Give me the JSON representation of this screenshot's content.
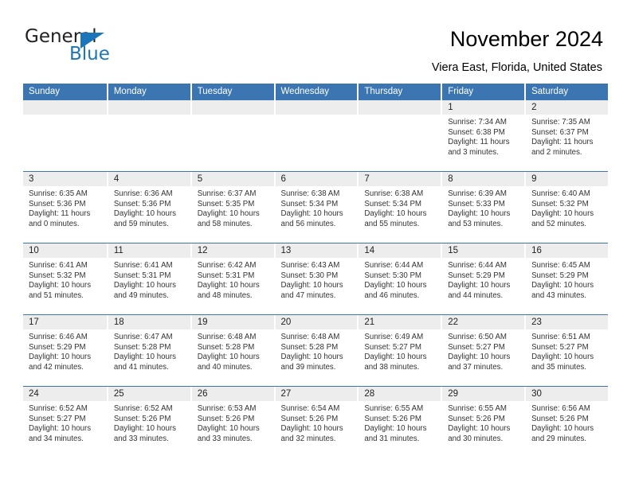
{
  "brand": {
    "name_part1": "General",
    "name_part2": "Blue",
    "accent_color": "#1b75bb",
    "triangle_icon": "triangle-icon"
  },
  "header": {
    "title": "November 2024",
    "subtitle": "Viera East, Florida, United States"
  },
  "calendar": {
    "header_bg": "#3b76b2",
    "daynum_bg": "#ededed",
    "weekday_headers": [
      "Sunday",
      "Monday",
      "Tuesday",
      "Wednesday",
      "Thursday",
      "Friday",
      "Saturday"
    ],
    "weeks": [
      [
        {
          "day": "",
          "sunrise": "",
          "sunset": "",
          "daylight": "",
          "empty": true
        },
        {
          "day": "",
          "sunrise": "",
          "sunset": "",
          "daylight": "",
          "empty": true
        },
        {
          "day": "",
          "sunrise": "",
          "sunset": "",
          "daylight": "",
          "empty": true
        },
        {
          "day": "",
          "sunrise": "",
          "sunset": "",
          "daylight": "",
          "empty": true
        },
        {
          "day": "",
          "sunrise": "",
          "sunset": "",
          "daylight": "",
          "empty": true
        },
        {
          "day": "1",
          "sunrise": "Sunrise: 7:34 AM",
          "sunset": "Sunset: 6:38 PM",
          "daylight": "Daylight: 11 hours and 3 minutes.",
          "empty": false
        },
        {
          "day": "2",
          "sunrise": "Sunrise: 7:35 AM",
          "sunset": "Sunset: 6:37 PM",
          "daylight": "Daylight: 11 hours and 2 minutes.",
          "empty": false
        }
      ],
      [
        {
          "day": "3",
          "sunrise": "Sunrise: 6:35 AM",
          "sunset": "Sunset: 5:36 PM",
          "daylight": "Daylight: 11 hours and 0 minutes.",
          "empty": false
        },
        {
          "day": "4",
          "sunrise": "Sunrise: 6:36 AM",
          "sunset": "Sunset: 5:36 PM",
          "daylight": "Daylight: 10 hours and 59 minutes.",
          "empty": false
        },
        {
          "day": "5",
          "sunrise": "Sunrise: 6:37 AM",
          "sunset": "Sunset: 5:35 PM",
          "daylight": "Daylight: 10 hours and 58 minutes.",
          "empty": false
        },
        {
          "day": "6",
          "sunrise": "Sunrise: 6:38 AM",
          "sunset": "Sunset: 5:34 PM",
          "daylight": "Daylight: 10 hours and 56 minutes.",
          "empty": false
        },
        {
          "day": "7",
          "sunrise": "Sunrise: 6:38 AM",
          "sunset": "Sunset: 5:34 PM",
          "daylight": "Daylight: 10 hours and 55 minutes.",
          "empty": false
        },
        {
          "day": "8",
          "sunrise": "Sunrise: 6:39 AM",
          "sunset": "Sunset: 5:33 PM",
          "daylight": "Daylight: 10 hours and 53 minutes.",
          "empty": false
        },
        {
          "day": "9",
          "sunrise": "Sunrise: 6:40 AM",
          "sunset": "Sunset: 5:32 PM",
          "daylight": "Daylight: 10 hours and 52 minutes.",
          "empty": false
        }
      ],
      [
        {
          "day": "10",
          "sunrise": "Sunrise: 6:41 AM",
          "sunset": "Sunset: 5:32 PM",
          "daylight": "Daylight: 10 hours and 51 minutes.",
          "empty": false
        },
        {
          "day": "11",
          "sunrise": "Sunrise: 6:41 AM",
          "sunset": "Sunset: 5:31 PM",
          "daylight": "Daylight: 10 hours and 49 minutes.",
          "empty": false
        },
        {
          "day": "12",
          "sunrise": "Sunrise: 6:42 AM",
          "sunset": "Sunset: 5:31 PM",
          "daylight": "Daylight: 10 hours and 48 minutes.",
          "empty": false
        },
        {
          "day": "13",
          "sunrise": "Sunrise: 6:43 AM",
          "sunset": "Sunset: 5:30 PM",
          "daylight": "Daylight: 10 hours and 47 minutes.",
          "empty": false
        },
        {
          "day": "14",
          "sunrise": "Sunrise: 6:44 AM",
          "sunset": "Sunset: 5:30 PM",
          "daylight": "Daylight: 10 hours and 46 minutes.",
          "empty": false
        },
        {
          "day": "15",
          "sunrise": "Sunrise: 6:44 AM",
          "sunset": "Sunset: 5:29 PM",
          "daylight": "Daylight: 10 hours and 44 minutes.",
          "empty": false
        },
        {
          "day": "16",
          "sunrise": "Sunrise: 6:45 AM",
          "sunset": "Sunset: 5:29 PM",
          "daylight": "Daylight: 10 hours and 43 minutes.",
          "empty": false
        }
      ],
      [
        {
          "day": "17",
          "sunrise": "Sunrise: 6:46 AM",
          "sunset": "Sunset: 5:29 PM",
          "daylight": "Daylight: 10 hours and 42 minutes.",
          "empty": false
        },
        {
          "day": "18",
          "sunrise": "Sunrise: 6:47 AM",
          "sunset": "Sunset: 5:28 PM",
          "daylight": "Daylight: 10 hours and 41 minutes.",
          "empty": false
        },
        {
          "day": "19",
          "sunrise": "Sunrise: 6:48 AM",
          "sunset": "Sunset: 5:28 PM",
          "daylight": "Daylight: 10 hours and 40 minutes.",
          "empty": false
        },
        {
          "day": "20",
          "sunrise": "Sunrise: 6:48 AM",
          "sunset": "Sunset: 5:28 PM",
          "daylight": "Daylight: 10 hours and 39 minutes.",
          "empty": false
        },
        {
          "day": "21",
          "sunrise": "Sunrise: 6:49 AM",
          "sunset": "Sunset: 5:27 PM",
          "daylight": "Daylight: 10 hours and 38 minutes.",
          "empty": false
        },
        {
          "day": "22",
          "sunrise": "Sunrise: 6:50 AM",
          "sunset": "Sunset: 5:27 PM",
          "daylight": "Daylight: 10 hours and 37 minutes.",
          "empty": false
        },
        {
          "day": "23",
          "sunrise": "Sunrise: 6:51 AM",
          "sunset": "Sunset: 5:27 PM",
          "daylight": "Daylight: 10 hours and 35 minutes.",
          "empty": false
        }
      ],
      [
        {
          "day": "24",
          "sunrise": "Sunrise: 6:52 AM",
          "sunset": "Sunset: 5:27 PM",
          "daylight": "Daylight: 10 hours and 34 minutes.",
          "empty": false
        },
        {
          "day": "25",
          "sunrise": "Sunrise: 6:52 AM",
          "sunset": "Sunset: 5:26 PM",
          "daylight": "Daylight: 10 hours and 33 minutes.",
          "empty": false
        },
        {
          "day": "26",
          "sunrise": "Sunrise: 6:53 AM",
          "sunset": "Sunset: 5:26 PM",
          "daylight": "Daylight: 10 hours and 33 minutes.",
          "empty": false
        },
        {
          "day": "27",
          "sunrise": "Sunrise: 6:54 AM",
          "sunset": "Sunset: 5:26 PM",
          "daylight": "Daylight: 10 hours and 32 minutes.",
          "empty": false
        },
        {
          "day": "28",
          "sunrise": "Sunrise: 6:55 AM",
          "sunset": "Sunset: 5:26 PM",
          "daylight": "Daylight: 10 hours and 31 minutes.",
          "empty": false
        },
        {
          "day": "29",
          "sunrise": "Sunrise: 6:55 AM",
          "sunset": "Sunset: 5:26 PM",
          "daylight": "Daylight: 10 hours and 30 minutes.",
          "empty": false
        },
        {
          "day": "30",
          "sunrise": "Sunrise: 6:56 AM",
          "sunset": "Sunset: 5:26 PM",
          "daylight": "Daylight: 10 hours and 29 minutes.",
          "empty": false
        }
      ]
    ]
  }
}
